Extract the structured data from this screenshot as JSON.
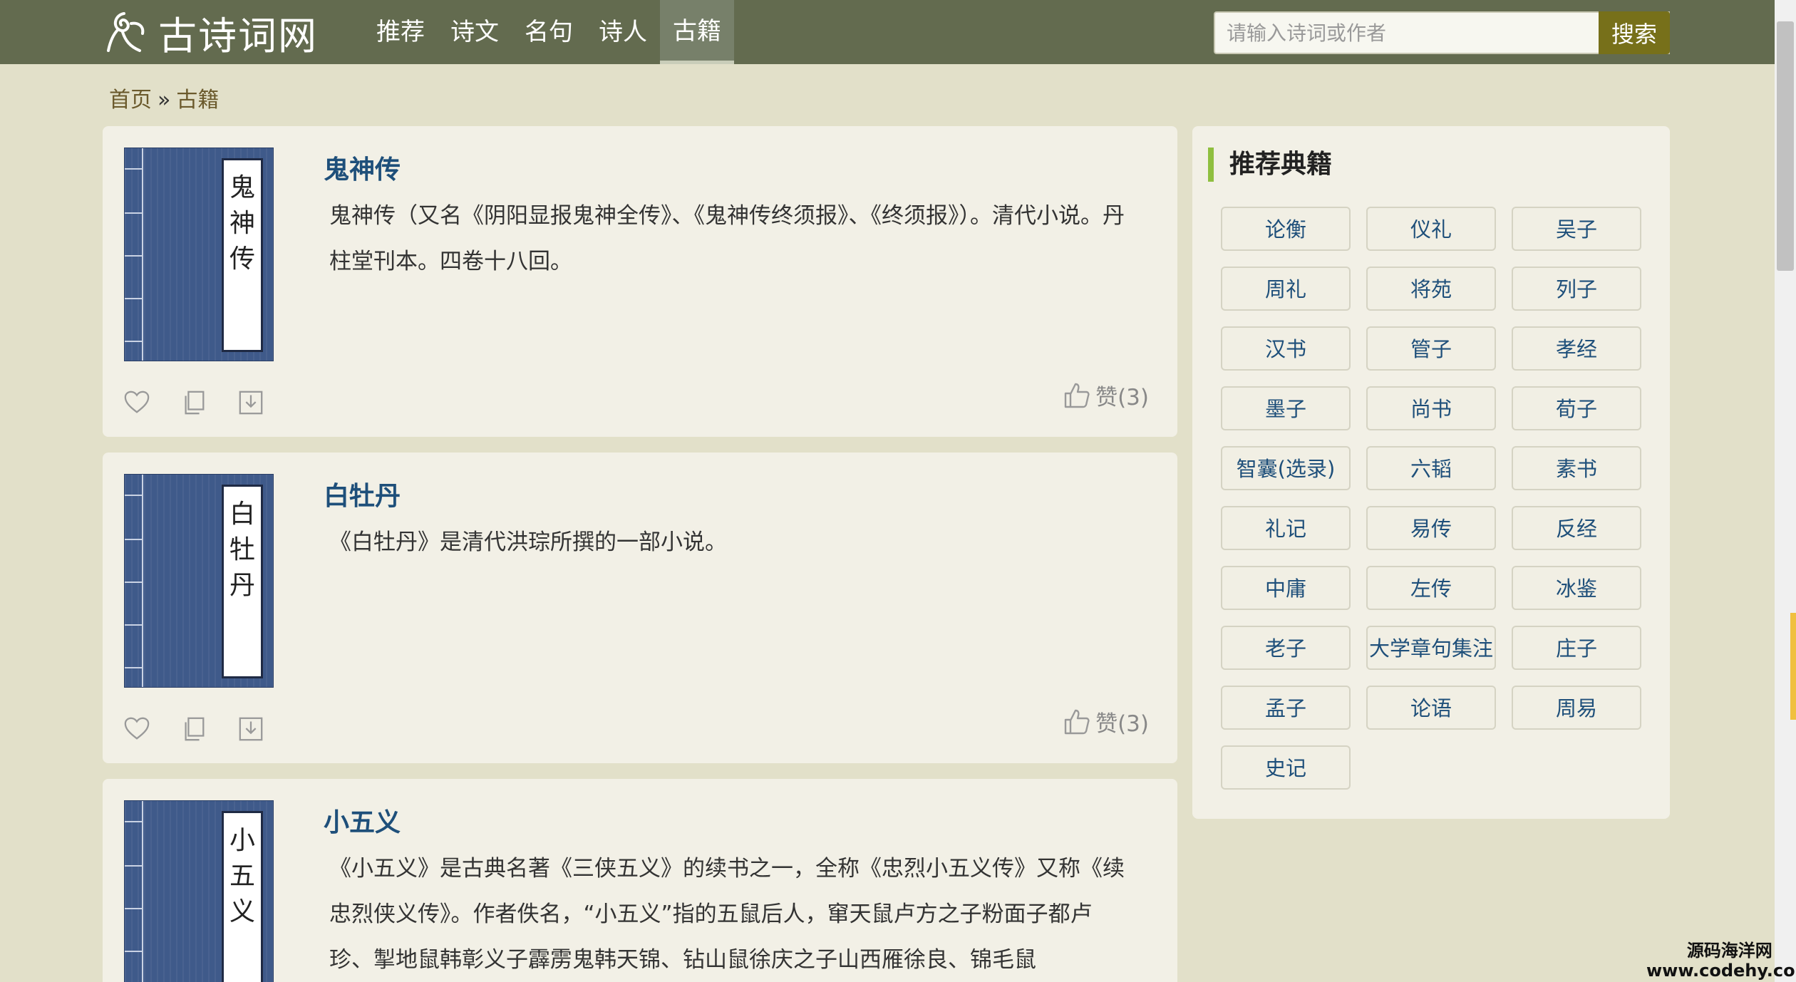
{
  "header": {
    "logo_text": "古诗词网",
    "nav": [
      "推荐",
      "诗文",
      "名句",
      "诗人",
      "古籍"
    ],
    "active_index": 4,
    "search_placeholder": "请输入诗词或作者",
    "search_button": "搜索"
  },
  "breadcrumb": {
    "home": "首页",
    "separator": "»",
    "current": "古籍"
  },
  "books": [
    {
      "title": "鬼神传",
      "cover_chars": [
        "鬼",
        "神",
        "传"
      ],
      "desc": "鬼神传（又名《阴阳显报鬼神全传》、《鬼神传终须报》、《终须报》）。清代小说。丹柱堂刊本。四卷十八回。",
      "like_label": "赞(3)"
    },
    {
      "title": "白牡丹",
      "cover_chars": [
        "白",
        "牡",
        "丹"
      ],
      "desc": "《白牡丹》是清代洪琮所撰的一部小说。",
      "like_label": "赞(3)"
    },
    {
      "title": "小五义",
      "cover_chars": [
        "小",
        "五",
        "义"
      ],
      "desc": "《小五义》是古典名著《三侠五义》的续书之一，全称《忠烈小五义传》又称《续忠烈侠义传》。作者佚名，“小五义”指的五鼠后人，窜天鼠卢方之子粉面子都卢珍、掣地鼠韩彰义子霹雳鬼韩天锦、钻山鼠徐庆之子山西雁徐良、锦毛鼠",
      "like_label": ""
    }
  ],
  "sidebar": {
    "title": "推荐典籍",
    "tags": [
      "论衡",
      "仪礼",
      "吴子",
      "周礼",
      "将苑",
      "列子",
      "汉书",
      "管子",
      "孝经",
      "墨子",
      "尚书",
      "荀子",
      "智囊(选录)",
      "六韬",
      "素书",
      "礼记",
      "易传",
      "反经",
      "中庸",
      "左传",
      "冰鉴",
      "老子",
      "大学章句集注",
      "庄子",
      "孟子",
      "论语",
      "周易",
      "史记"
    ]
  },
  "watermark": {
    "line1": "源码海洋网",
    "line2": "www.codehy.com"
  },
  "colors": {
    "header_bg": "#636b4f",
    "page_bg": "#e2e0c9",
    "title_link": "#1e4f7a",
    "accent_bar": "#8fbf3f",
    "search_btn": "#77701a"
  }
}
